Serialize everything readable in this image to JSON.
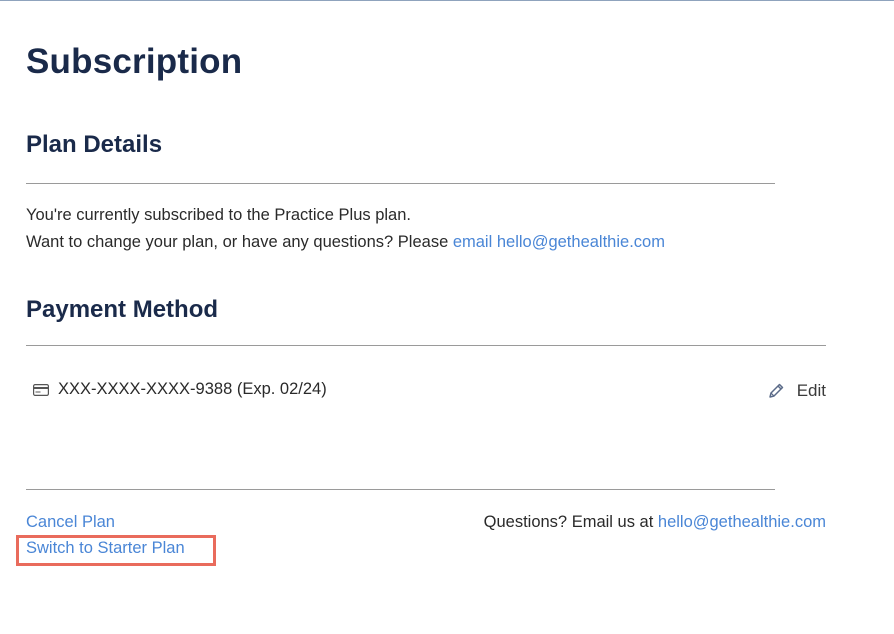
{
  "page": {
    "title": "Subscription"
  },
  "plan_details": {
    "heading": "Plan Details",
    "current_plan_text": "You're currently subscribed to the Practice Plus plan.",
    "change_prompt": "Want to change your plan, or have any questions? Please ",
    "email_link": "email hello@gethealthie.com"
  },
  "payment_method": {
    "heading": "Payment Method",
    "card_icon": "credit-card-icon",
    "card_text": "XXX-XXXX-XXXX-9388 (Exp. 02/24)",
    "edit_icon": "pencil-icon",
    "edit_label": "Edit"
  },
  "footer": {
    "cancel_link": "Cancel Plan",
    "switch_link": "Switch to Starter Plan",
    "questions_text": "Questions? Email us at ",
    "questions_email": "hello@gethealthie.com"
  },
  "colors": {
    "heading": "#1a2a4a",
    "link": "#4a86d6",
    "highlight_border": "#e96b5c",
    "rule": "#9a9a9a"
  }
}
